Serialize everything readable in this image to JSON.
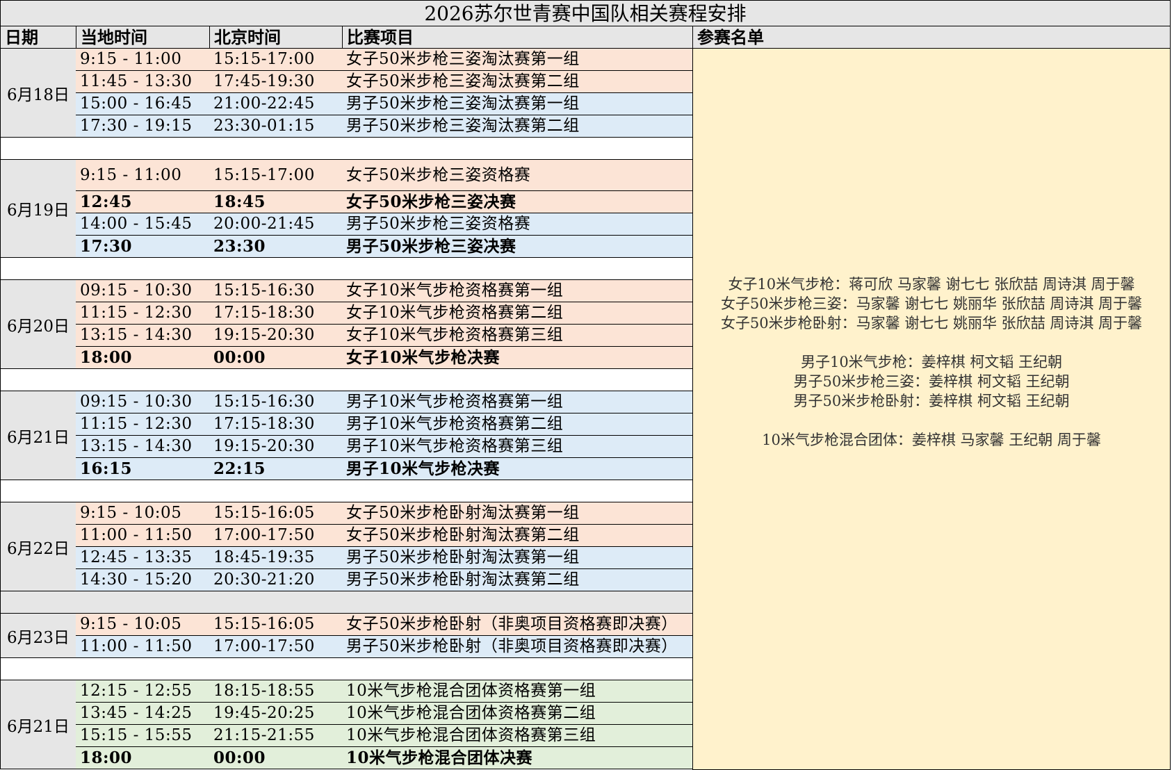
{
  "title": "2026苏尔世青赛中国队相关赛程安排",
  "headers": {
    "date": "日期",
    "local": "当地时间",
    "beijing": "北京时间",
    "event": "比赛项目",
    "roster": "参赛名单"
  },
  "days": [
    {
      "date": "6月18日",
      "rows": [
        {
          "local": "9:15 - 11:00",
          "beijing": "15:15-17:00",
          "event": "女子50米步枪三姿淘汰赛第一组",
          "color": "#fce4d6",
          "bold": false
        },
        {
          "local": "11:45 - 13:30",
          "beijing": "17:45-19:30",
          "event": "女子50米步枪三姿淘汰赛第二组",
          "color": "#fce4d6",
          "bold": false
        },
        {
          "local": "15:00 - 16:45",
          "beijing": "21:00-22:45",
          "event": "男子50米步枪三姿淘汰赛第一组",
          "color": "#ddebf7",
          "bold": false
        },
        {
          "local": "17:30 - 19:15",
          "beijing": "23:30-01:15",
          "event": "男子50米步枪三姿淘汰赛第二组",
          "color": "#ddebf7",
          "bold": false
        }
      ]
    },
    {
      "date": "6月19日",
      "rows": [
        {
          "local": "9:15 - 11:00",
          "beijing": "15:15-17:00",
          "event": "女子50米步枪三姿资格赛",
          "color": "#fce4d6",
          "bold": false
        },
        {
          "local": "12:45",
          "beijing": "18:45",
          "event": "女子50米步枪三姿决赛",
          "color": "#fce4d6",
          "bold": true
        },
        {
          "local": "14:00 - 15:45",
          "beijing": "20:00-21:45",
          "event": "男子50米步枪三姿资格赛",
          "color": "#ddebf7",
          "bold": false
        },
        {
          "local": "17:30",
          "beijing": "23:30",
          "event": "男子50米步枪三姿决赛",
          "color": "#ddebf7",
          "bold": true
        }
      ]
    },
    {
      "date": "6月20日",
      "rows": [
        {
          "local": "09:15 - 10:30",
          "beijing": "15:15-16:30",
          "event": "女子10米气步枪资格赛第一组",
          "color": "#fce4d6",
          "bold": false
        },
        {
          "local": "11:15 - 12:30",
          "beijing": "17:15-18:30",
          "event": "女子10米气步枪资格赛第二组",
          "color": "#fce4d6",
          "bold": false
        },
        {
          "local": "13:15 - 14:30",
          "beijing": "19:15-20:30",
          "event": "女子10米气步枪资格赛第三组",
          "color": "#fce4d6",
          "bold": false
        },
        {
          "local": "18:00",
          "beijing": "00:00",
          "event": "女子10米气步枪决赛",
          "color": "#fce4d6",
          "bold": true
        }
      ]
    },
    {
      "date": "6月21日",
      "rows": [
        {
          "local": "09:15 - 10:30",
          "beijing": "15:15-16:30",
          "event": "男子10米气步枪资格赛第一组",
          "color": "#ddebf7",
          "bold": false
        },
        {
          "local": "11:15 - 12:30",
          "beijing": "17:15-18:30",
          "event": "男子10米气步枪资格赛第二组",
          "color": "#ddebf7",
          "bold": false
        },
        {
          "local": "13:15 - 14:30",
          "beijing": "19:15-20:30",
          "event": "男子10米气步枪资格赛第三组",
          "color": "#ddebf7",
          "bold": false
        },
        {
          "local": "16:15",
          "beijing": "22:15",
          "event": "男子10米气步枪决赛",
          "color": "#ddebf7",
          "bold": true
        }
      ]
    },
    {
      "date": "6月22日",
      "rows": [
        {
          "local": "9:15 - 10:05",
          "beijing": "15:15-16:05",
          "event": "女子50米步枪卧射淘汰赛第一组",
          "color": "#fce4d6",
          "bold": false
        },
        {
          "local": "11:00 - 11:50",
          "beijing": "17:00-17:50",
          "event": "女子50米步枪卧射淘汰赛第二组",
          "color": "#fce4d6",
          "bold": false
        },
        {
          "local": "12:45 - 13:35",
          "beijing": "18:45-19:35",
          "event": "男子50米步枪卧射淘汰赛第一组",
          "color": "#ddebf7",
          "bold": false
        },
        {
          "local": "14:30 - 15:20",
          "beijing": "20:30-21:20",
          "event": "男子50米步枪卧射淘汰赛第二组",
          "color": "#ddebf7",
          "bold": false
        }
      ]
    },
    {
      "date": "6月23日",
      "rows": [
        {
          "local": "9:15 - 10:05",
          "beijing": "15:15-16:05",
          "event": "女子50米步枪卧射（非奥项目资格赛即决赛）",
          "color": "#fce4d6",
          "bold": false
        },
        {
          "local": "11:00 - 11:50",
          "beijing": "17:00-17:50",
          "event": "男子50米步枪卧射（非奥项目资格赛即决赛）",
          "color": "#ddebf7",
          "bold": false
        }
      ]
    },
    {
      "date": "6月21日",
      "rows": [
        {
          "local": "12:15 - 12:55",
          "beijing": "18:15-18:55",
          "event": "10米气步枪混合团体资格赛第一组",
          "color": "#e2efda",
          "bold": false
        },
        {
          "local": "13:45 - 14:25",
          "beijing": "19:45-20:25",
          "event": "10米气步枪混合团体资格赛第二组",
          "color": "#e2efda",
          "bold": false
        },
        {
          "local": "15:15 - 15:55",
          "beijing": "21:15-21:55",
          "event": "10米气步枪混合团体资格赛第三组",
          "color": "#e2efda",
          "bold": false
        },
        {
          "local": "18:00",
          "beijing": "00:00",
          "event": "10米气步枪混合团体决赛",
          "color": "#e2efda",
          "bold": true
        }
      ]
    }
  ],
  "roster": [
    "女子10米气步枪：蒋可欣  马家馨  谢七七  张欣喆  周诗淇  周于馨",
    "女子50米步枪三姿：马家馨  谢七七  姚丽华  张欣喆  周诗淇  周于馨",
    "女子50米步枪卧射：马家馨  谢七七  姚丽华  张欣喆  周诗淇  周于馨",
    "",
    "男子10米气步枪：姜梓棋  柯文韬  王纪朝",
    "男子50米步枪三姿：姜梓棋  柯文韬  王纪朝",
    "男子50米步枪卧射：姜梓棋  柯文韬  王纪朝",
    "",
    "10米气步枪混合团体：姜梓棋  马家馨  王纪朝    周于馨"
  ]
}
